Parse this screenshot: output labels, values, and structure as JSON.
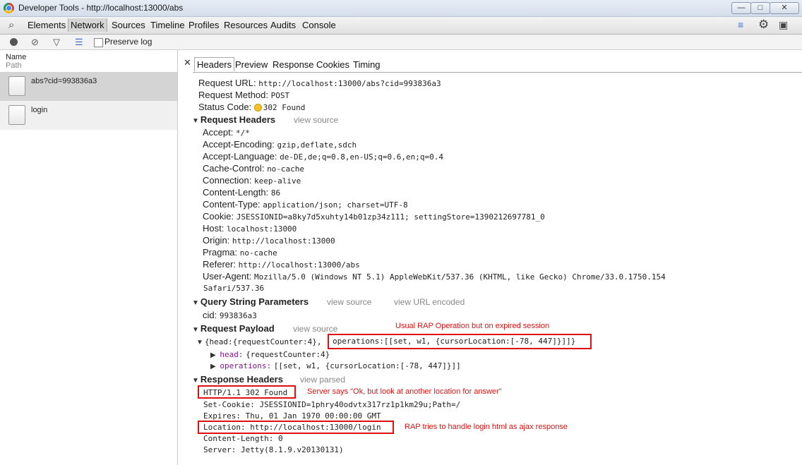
{
  "window": {
    "title": "Developer Tools - http://localhost:13000/abs",
    "min": "—",
    "max": "□",
    "close": "✕"
  },
  "toolbar": {
    "tabs": [
      "Elements",
      "Network",
      "Sources",
      "Timeline",
      "Profiles",
      "Resources",
      "Audits",
      "Console"
    ]
  },
  "subtoolbar": {
    "preserve_log": "Preserve log"
  },
  "list": {
    "col_name": "Name",
    "col_path": "Path",
    "items": [
      {
        "name": "abs?cid=993836a3"
      },
      {
        "name": "login"
      }
    ]
  },
  "detail": {
    "tabs": [
      "Headers",
      "Preview",
      "Response",
      "Cookies",
      "Timing"
    ],
    "general": [
      {
        "label": "Request URL:",
        "value": "http://localhost:13000/abs?cid=993836a3"
      },
      {
        "label": "Request Method:",
        "value": "POST"
      },
      {
        "label": "Status Code:",
        "value": "302 Found"
      }
    ],
    "view_source": "view source",
    "view_url_encoded": "view URL encoded",
    "view_parsed": "view parsed",
    "request_headers_title": "Request Headers",
    "request_headers": [
      {
        "label": "Accept:",
        "value": "*/*"
      },
      {
        "label": "Accept-Encoding:",
        "value": "gzip,deflate,sdch"
      },
      {
        "label": "Accept-Language:",
        "value": "de-DE,de;q=0.8,en-US;q=0.6,en;q=0.4"
      },
      {
        "label": "Cache-Control:",
        "value": "no-cache"
      },
      {
        "label": "Connection:",
        "value": "keep-alive"
      },
      {
        "label": "Content-Length:",
        "value": "86"
      },
      {
        "label": "Content-Type:",
        "value": "application/json; charset=UTF-8"
      },
      {
        "label": "Cookie:",
        "value": "JSESSIONID=a8ky7d5xuhty14b01zp34z111; settingStore=1390212697781_0"
      },
      {
        "label": "Host:",
        "value": "localhost:13000"
      },
      {
        "label": "Origin:",
        "value": "http://localhost:13000"
      },
      {
        "label": "Pragma:",
        "value": "no-cache"
      },
      {
        "label": "Referer:",
        "value": "http://localhost:13000/abs"
      },
      {
        "label": "User-Agent:",
        "value": "Mozilla/5.0 (Windows NT 5.1) AppleWebKit/537.36 (KHTML, like Gecko) Chrome/33.0.1750.154"
      }
    ],
    "user_agent_cont": "Safari/537.36",
    "query_title": "Query String Parameters",
    "query": {
      "label": "cid:",
      "value": "993836a3"
    },
    "payload_title": "Request Payload",
    "payload_prefix": "{head:{requestCounter:4},",
    "payload_boxed": "operations:[[set, w1, {cursorLocation:[-78, 447]}]]}",
    "payload_head": {
      "key": "head:",
      "value": "{requestCounter:4}"
    },
    "payload_ops": {
      "key": "operations:",
      "value": "[[set, w1, {cursorLocation:[-78, 447]}]]"
    },
    "response_title": "Response Headers",
    "response_lines": [
      "HTTP/1.1 302 Found",
      "Set-Cookie: JSESSIONID=1phry40odvtx317rz1p1km29u;Path=/",
      "Expires: Thu, 01 Jan 1970 00:00:00 GMT",
      "Location: http://localhost:13000/login",
      "Content-Length: 0",
      "Server: Jetty(8.1.9.v20130131)"
    ]
  },
  "annotations": {
    "payload": "Usual RAP Operation but on expired session",
    "status": "Server says \"Ok, but look at another location for answer\"",
    "location": "RAP tries to handle login html as ajax response"
  },
  "colors": {
    "annotation": "#e01010",
    "selected_row": "#d4d4d4",
    "payload_key": "#881391"
  }
}
